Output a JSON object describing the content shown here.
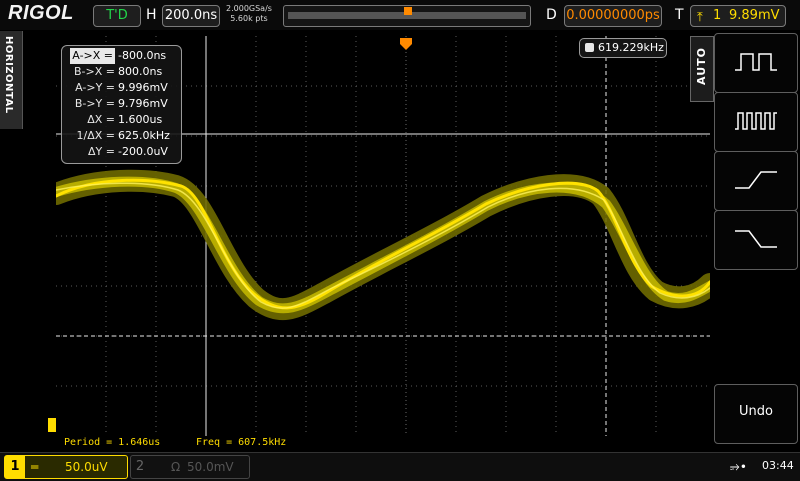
{
  "brand": "RIGOL",
  "top": {
    "run_state": "T'D",
    "time_label": "H",
    "time_base": "200.0ns",
    "sample_rate": "2.000GSa/s",
    "memory_depth": "5.60k pts",
    "delay_label": "D",
    "delay_value": "0.00000000ps",
    "trigger_label": "T",
    "trigger_source": "1",
    "trigger_level": "9.89mV"
  },
  "side_tab": "HORIZONTAL",
  "cursor": {
    "rows": [
      {
        "label": "A->X =",
        "value": "-800.0ns"
      },
      {
        "label": "B->X =",
        "value": "800.0ns"
      },
      {
        "label": "A->Y =",
        "value": "9.996mV"
      },
      {
        "label": "B->Y =",
        "value": "9.796mV"
      },
      {
        "label": "ΔX =",
        "value": "1.600us"
      },
      {
        "label": "1/ΔX =",
        "value": "625.0kHz"
      },
      {
        "label": "ΔY =",
        "value": "-200.0uV"
      }
    ]
  },
  "freq_counter": "619.229kHz",
  "right_menu": {
    "tab": "AUTO",
    "buttons": [
      {
        "icon": "pulse-single-icon"
      },
      {
        "icon": "pulse-multi-icon"
      },
      {
        "icon": "rising-edge-icon"
      },
      {
        "icon": "falling-edge-icon"
      }
    ],
    "undo_label": "Undo"
  },
  "measurements": {
    "period": "Period = 1.646us",
    "freq": "Freq = 607.5kHz"
  },
  "channels": {
    "ch1": {
      "number": "1",
      "coupling": "═",
      "scale": "50.0uV"
    },
    "ch2": {
      "number": "2",
      "impedance": "Ω",
      "scale": "50.0mV"
    }
  },
  "clock": "03:44",
  "colors": {
    "ch1": "#ffdd00",
    "accent": "#ff8a00",
    "run_state": "#22d64a"
  }
}
